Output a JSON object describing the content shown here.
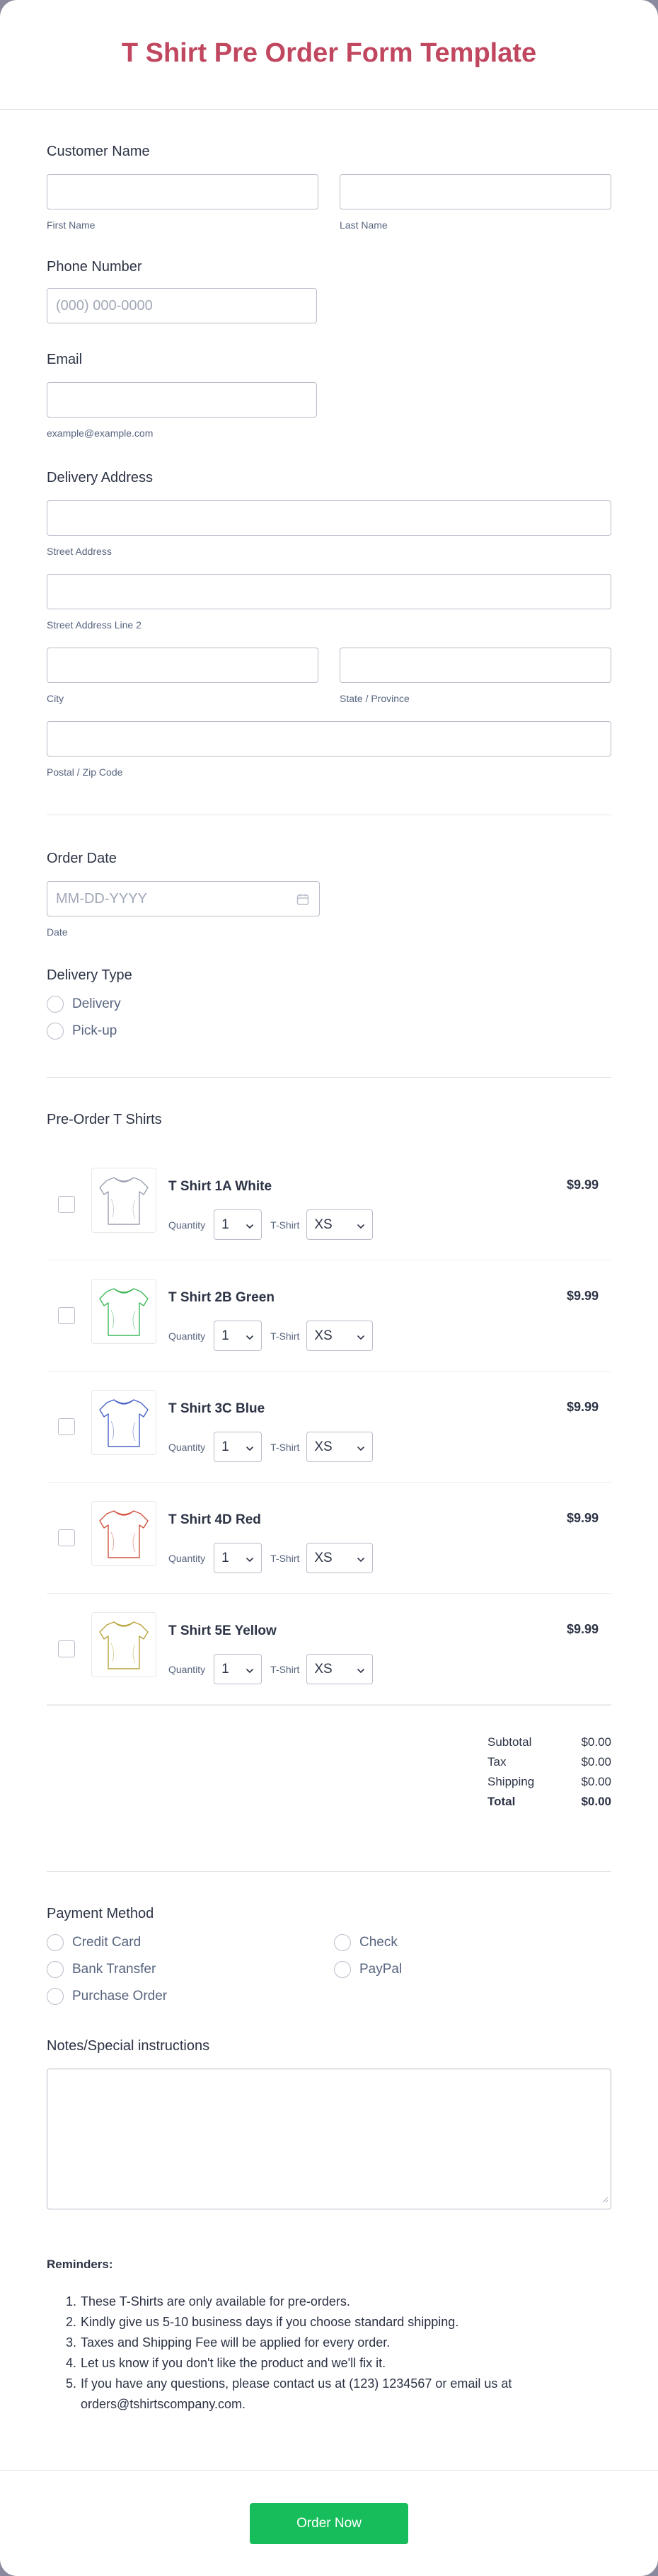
{
  "form": {
    "title": "T Shirt Pre Order Form Template",
    "customer_name": {
      "label": "Customer Name",
      "first_sublabel": "First Name",
      "last_sublabel": "Last Name"
    },
    "phone": {
      "label": "Phone Number",
      "placeholder": "(000) 000-0000"
    },
    "email": {
      "label": "Email",
      "sublabel": "example@example.com"
    },
    "address": {
      "label": "Delivery Address",
      "street": "Street Address",
      "street2": "Street Address Line 2",
      "city": "City",
      "state": "State / Province",
      "zip": "Postal / Zip Code"
    },
    "order_date": {
      "label": "Order Date",
      "placeholder": "MM-DD-YYYY",
      "sublabel": "Date"
    },
    "delivery_type": {
      "label": "Delivery Type",
      "options": [
        "Delivery",
        "Pick-up"
      ]
    },
    "preorder": {
      "label": "Pre-Order T Shirts",
      "quantity_label": "Quantity",
      "size_label": "T-Shirt",
      "products": [
        {
          "name": "T Shirt 1A White",
          "price": "$9.99",
          "qty": "1",
          "size": "XS",
          "color": "#9aa0b0"
        },
        {
          "name": "T Shirt 2B Green",
          "price": "$9.99",
          "qty": "1",
          "size": "XS",
          "color": "#3fb85a"
        },
        {
          "name": "T Shirt 3C Blue",
          "price": "$9.99",
          "qty": "1",
          "size": "XS",
          "color": "#4a63c9"
        },
        {
          "name": "T Shirt 4D Red",
          "price": "$9.99",
          "qty": "1",
          "size": "XS",
          "color": "#d0533f"
        },
        {
          "name": "T Shirt 5E Yellow",
          "price": "$9.99",
          "qty": "1",
          "size": "XS",
          "color": "#b8a33c"
        }
      ],
      "totals": {
        "subtotal_label": "Subtotal",
        "subtotal": "$0.00",
        "tax_label": "Tax",
        "tax": "$0.00",
        "shipping_label": "Shipping",
        "shipping": "$0.00",
        "total_label": "Total",
        "total": "$0.00"
      }
    },
    "payment": {
      "label": "Payment Method",
      "options": [
        "Credit Card",
        "Check",
        "Bank Transfer",
        "PayPal",
        "Purchase Order"
      ]
    },
    "notes": {
      "label": "Notes/Special instructions"
    },
    "reminders": {
      "title": "Reminders:",
      "items": [
        "These T-Shirts are only available for pre-orders.",
        "Kindly give us 5-10 business days if you choose standard shipping.",
        "Taxes and Shipping Fee will be applied for every order.",
        "Let us know if you don't like the product and we'll fix it.",
        "If you have any questions, please contact us at (123) 1234567 or email us at orders@tshirtscompany.com."
      ]
    },
    "submit_label": "Order Now"
  },
  "colors": {
    "title": "#c0475f",
    "submit": "#18bd5b"
  }
}
